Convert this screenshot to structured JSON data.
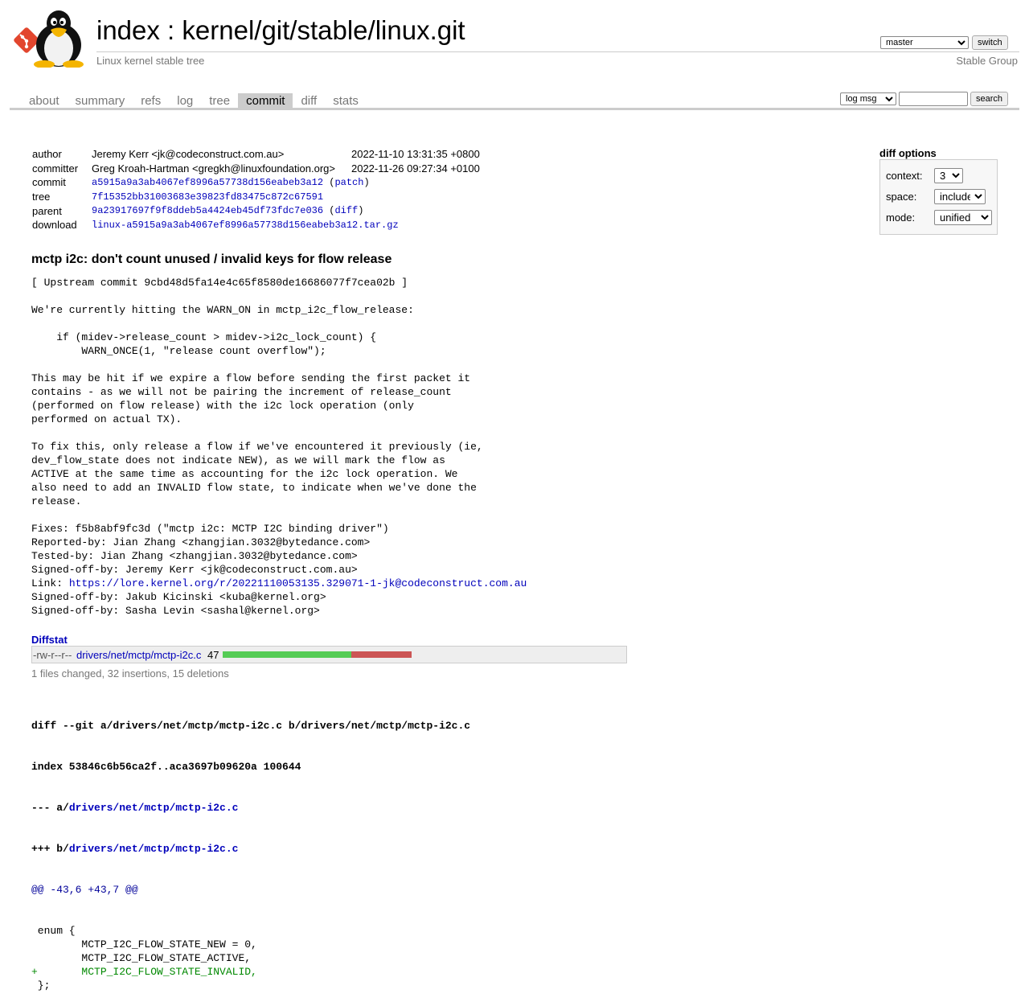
{
  "header": {
    "repo_index": "index",
    "repo_sep": " : ",
    "repo_path": "kernel/git/stable/linux.git",
    "description": "Linux kernel stable tree",
    "owner": "Stable Group",
    "branch": "master",
    "switch_label": "switch"
  },
  "tabs": [
    {
      "label": "about",
      "active": false
    },
    {
      "label": "summary",
      "active": false
    },
    {
      "label": "refs",
      "active": false
    },
    {
      "label": "log",
      "active": false
    },
    {
      "label": "tree",
      "active": false
    },
    {
      "label": "commit",
      "active": true
    },
    {
      "label": "diff",
      "active": false
    },
    {
      "label": "stats",
      "active": false
    }
  ],
  "search": {
    "type": "log msg",
    "value": "",
    "button": "search"
  },
  "commit_info": {
    "author_label": "author",
    "author": "Jeremy Kerr <jk@codeconstruct.com.au>",
    "author_date": "2022-11-10 13:31:35 +0800",
    "committer_label": "committer",
    "committer": "Greg Kroah-Hartman <gregkh@linuxfoundation.org>",
    "committer_date": "2022-11-26 09:27:34 +0100",
    "commit_label": "commit",
    "commit": "a5915a9a3ab4067ef8996a57738d156eabeb3a12",
    "patch_link": "patch",
    "tree_label": "tree",
    "tree": "7f15352bb31003683e39823fd83475c872c67591",
    "parent_label": "parent",
    "parent": "9a23917697f9f8ddeb5a4424eb45df73fdc7e036",
    "diff_link": "diff",
    "download_label": "download",
    "download": "linux-a5915a9a3ab4067ef8996a57738d156eabeb3a12.tar.gz"
  },
  "diff_options": {
    "title": "diff options",
    "context_label": "context:",
    "context": "3",
    "space_label": "space:",
    "space": "include",
    "mode_label": "mode:",
    "mode": "unified"
  },
  "message": {
    "subject": "mctp i2c: don't count unused / invalid keys for flow release",
    "body_before_link": "[ Upstream commit 9cbd48d5fa14e4c65f8580de16686077f7cea02b ]\n\nWe're currently hitting the WARN_ON in mctp_i2c_flow_release:\n\n    if (midev->release_count > midev->i2c_lock_count) {\n        WARN_ONCE(1, \"release count overflow\");\n\nThis may be hit if we expire a flow before sending the first packet it\ncontains - as we will not be pairing the increment of release_count\n(performed on flow release) with the i2c lock operation (only\nperformed on actual TX).\n\nTo fix this, only release a flow if we've encountered it previously (ie,\ndev_flow_state does not indicate NEW), as we will mark the flow as\nACTIVE at the same time as accounting for the i2c lock operation. We\nalso need to add an INVALID flow state, to indicate when we've done the\nrelease.\n\nFixes: f5b8abf9fc3d (\"mctp i2c: MCTP I2C binding driver\")\nReported-by: Jian Zhang <zhangjian.3032@bytedance.com>\nTested-by: Jian Zhang <zhangjian.3032@bytedance.com>\nSigned-off-by: Jeremy Kerr <jk@codeconstruct.com.au>\nLink: ",
    "link": "https://lore.kernel.org/r/20221110053135.329071-1-jk@codeconstruct.com.au",
    "body_after_link": "\nSigned-off-by: Jakub Kicinski <kuba@kernel.org>\nSigned-off-by: Sasha Levin <sashal@kernel.org>"
  },
  "diffstat": {
    "header": "Diffstat",
    "mode": "-rw-r--r--",
    "file": "drivers/net/mctp/mctp-i2c.c",
    "changes": "47",
    "insertions": 32,
    "deletions": 15,
    "summary": "1 files changed, 32 insertions, 15 deletions"
  },
  "diff": {
    "head1": "diff --git a/drivers/net/mctp/mctp-i2c.c b/drivers/net/mctp/mctp-i2c.c",
    "head2": "index 53846c6b56ca2f..aca3697b09620a 100644",
    "minus_prefix": "--- a/",
    "minus_file": "drivers/net/mctp/mctp-i2c.c",
    "plus_prefix": "+++ b/",
    "plus_file": "drivers/net/mctp/mctp-i2c.c",
    "hunk": "@@ -43,6 +43,7 @@",
    "lines": [
      " enum {",
      " \tMCTP_I2C_FLOW_STATE_NEW = 0,",
      " \tMCTP_I2C_FLOW_STATE_ACTIVE,",
      "+\tMCTP_I2C_FLOW_STATE_INVALID,",
      " };"
    ]
  }
}
